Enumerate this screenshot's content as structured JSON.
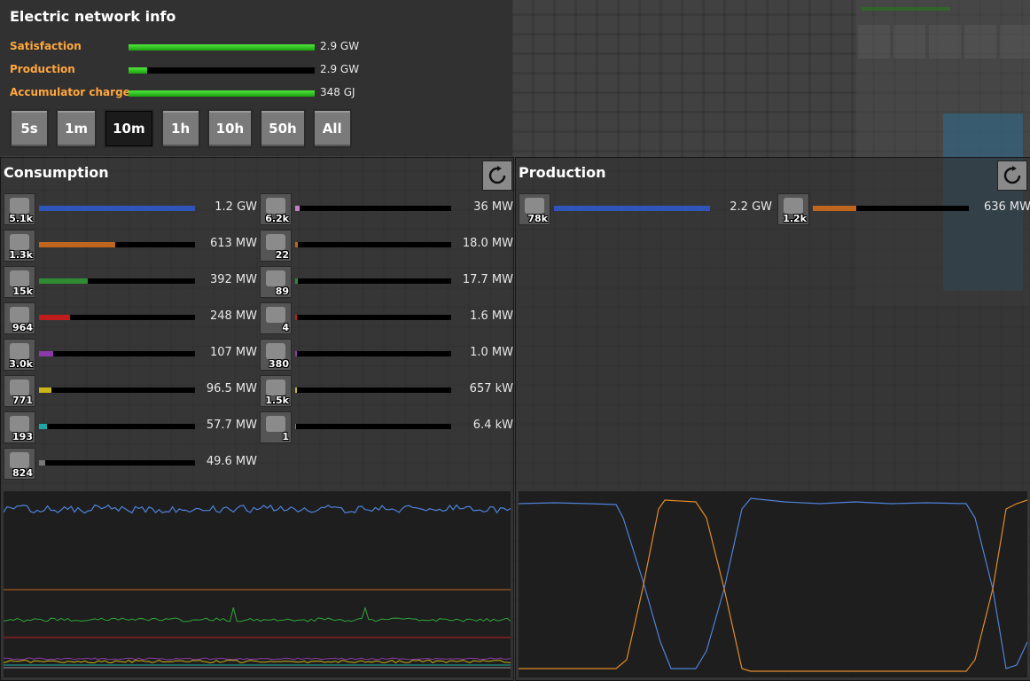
{
  "network_info": {
    "title": "Electric network info",
    "stats": [
      {
        "label": "Satisfaction",
        "value": "2.9 GW",
        "fill": 1.0
      },
      {
        "label": "Production",
        "value": "2.9 GW",
        "fill": 0.1
      },
      {
        "label": "Accumulator charge",
        "value": "348 GJ",
        "fill": 1.0
      }
    ],
    "time_buttons": [
      "5s",
      "1m",
      "10m",
      "1h",
      "10h",
      "50h",
      "All"
    ],
    "selected_time": "10m"
  },
  "consumption": {
    "title": "Consumption",
    "left_column": [
      {
        "icon": "assembling-machine-icon",
        "count": "5.1k",
        "value": "1.2 GW",
        "fill": 1.0,
        "color": "#2f55b8"
      },
      {
        "icon": "mining-drill-icon",
        "count": "1.3k",
        "value": "613 MW",
        "fill": 0.49,
        "color": "#c0651e"
      },
      {
        "icon": "electric-furnace-icon",
        "count": "15k",
        "value": "392 MW",
        "fill": 0.31,
        "color": "#2e8a33"
      },
      {
        "icon": "beacon-icon",
        "count": "964",
        "value": "248 MW",
        "fill": 0.2,
        "color": "#c01c1c"
      },
      {
        "icon": "oil-refinery-icon",
        "count": "3.0k",
        "value": "107 MW",
        "fill": 0.09,
        "color": "#8a3aa8"
      },
      {
        "icon": "lab-icon",
        "count": "771",
        "value": "96.5 MW",
        "fill": 0.08,
        "color": "#c9b515"
      },
      {
        "icon": "chemical-plant-icon",
        "count": "193",
        "value": "57.7 MW",
        "fill": 0.05,
        "color": "#1da8a8"
      },
      {
        "icon": "pumpjack-icon",
        "count": "824",
        "value": "49.6 MW",
        "fill": 0.04,
        "color": "#777777"
      }
    ],
    "right_column": [
      {
        "icon": "inserter-icon",
        "count": "6.2k",
        "value": "36 MW",
        "fill": 0.03,
        "color": "#c67ec6"
      },
      {
        "icon": "centrifuge-icon",
        "count": "22",
        "value": "18.0 MW",
        "fill": 0.015,
        "color": "#c0651e"
      },
      {
        "icon": "rocket-silo-icon",
        "count": "89",
        "value": "17.7 MW",
        "fill": 0.015,
        "color": "#2e8a33"
      },
      {
        "icon": "roboport-icon",
        "count": "4",
        "value": "1.6 MW",
        "fill": 0.002,
        "color": "#c01c1c"
      },
      {
        "icon": "radar-icon",
        "count": "380",
        "value": "1.0 MW",
        "fill": 0.002,
        "color": "#8a3aa8"
      },
      {
        "icon": "fast-inserter-icon",
        "count": "1.5k",
        "value": "657 kW",
        "fill": 0.001,
        "color": "#c9b515"
      },
      {
        "icon": "filter-inserter-icon",
        "count": "1",
        "value": "6.4 kW",
        "fill": 0.0,
        "color": "#1da8a8"
      }
    ]
  },
  "production": {
    "title": "Production",
    "entries": [
      {
        "icon": "solar-panel-icon",
        "count": "78k",
        "value": "2.2 GW",
        "fill": 1.0,
        "color": "#2f55b8"
      },
      {
        "icon": "accumulator-icon",
        "count": "1.2k",
        "value": "636 MW",
        "fill": 0.28,
        "color": "#c0651e"
      }
    ]
  },
  "colors": {
    "accent_label": "#ffa73d",
    "bar_green": "#3fd12f",
    "graph_blue": "#4f82d8",
    "graph_orange": "#e28a2a"
  }
}
